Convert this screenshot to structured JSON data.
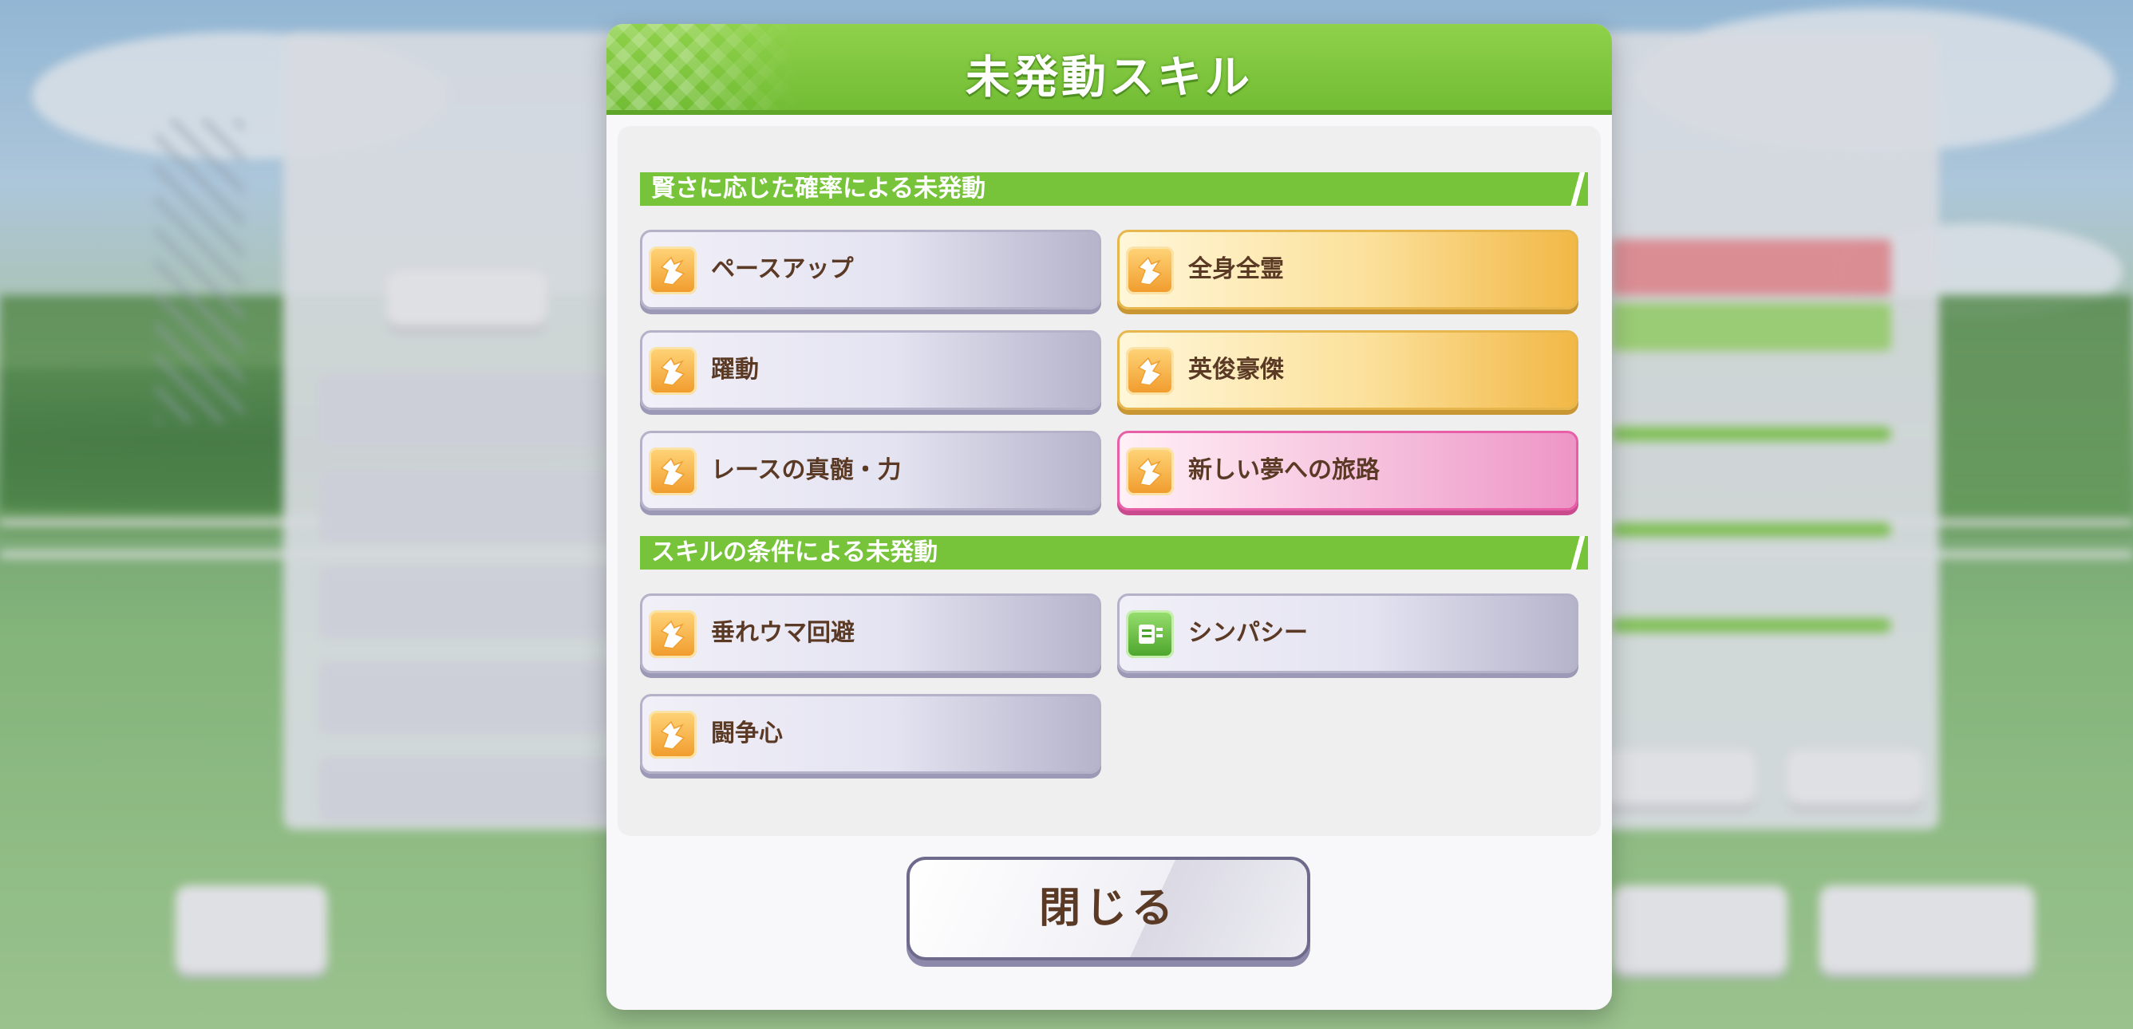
{
  "modal": {
    "title": "未発動スキル",
    "close_label": "閉じる"
  },
  "sections": [
    {
      "title": "賢さに応じた確率による未発動",
      "skills": [
        {
          "label": "ペースアップ",
          "rarity": "normal",
          "icon": "speed-skill-icon"
        },
        {
          "label": "全身全霊",
          "rarity": "gold",
          "icon": "speed-skill-icon"
        },
        {
          "label": "躍動",
          "rarity": "normal",
          "icon": "speed-skill-icon"
        },
        {
          "label": "英俊豪傑",
          "rarity": "gold",
          "icon": "speed-skill-icon"
        },
        {
          "label": "レースの真髄・力",
          "rarity": "normal",
          "icon": "speed-skill-icon"
        },
        {
          "label": "新しい夢への旅路",
          "rarity": "unique",
          "icon": "speed-skill-icon"
        }
      ]
    },
    {
      "title": "スキルの条件による未発動",
      "skills": [
        {
          "label": "垂れウマ回避",
          "rarity": "normal",
          "icon": "speed-skill-icon"
        },
        {
          "label": "シンパシー",
          "rarity": "normal",
          "icon": "green-stat-skill-icon"
        },
        {
          "label": "闘争心",
          "rarity": "normal",
          "icon": "speed-skill-icon"
        }
      ]
    }
  ],
  "colors": {
    "header_green": "#77c33a",
    "text_brown": "#5b3a25",
    "gold": "#f2b846",
    "pink": "#ee95c6"
  }
}
